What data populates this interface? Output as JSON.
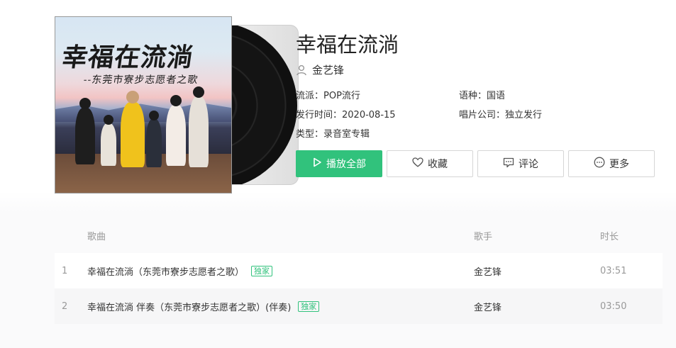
{
  "album": {
    "title": "幸福在流淌",
    "artist": "金艺锋",
    "cover_title": "幸福在流淌",
    "cover_subtitle": "--东莞市寮步志愿者之歌"
  },
  "meta": {
    "genre_label": "流派：POP流行",
    "language_label": "语种：国语",
    "release_label": "发行时间：2020-08-15",
    "company_label": "唱片公司：独立发行",
    "type_label": "类型：录音室专辑"
  },
  "actions": {
    "play_all": "播放全部",
    "favorite": "收藏",
    "comment": "评论",
    "more": "更多"
  },
  "colors": {
    "accent": "#31c27c"
  },
  "songlist": {
    "headers": {
      "song": "歌曲",
      "singer": "歌手",
      "duration": "时长"
    },
    "rows": [
      {
        "index": "1",
        "name": "幸福在流淌（东莞市寮步志愿者之歌）",
        "badge": "独家",
        "singer": "金艺锋",
        "duration": "03:51"
      },
      {
        "index": "2",
        "name": "幸福在流淌 伴奏（东莞市寮步志愿者之歌）(伴奏)",
        "badge": "独家",
        "singer": "金艺锋",
        "duration": "03:50"
      }
    ]
  }
}
